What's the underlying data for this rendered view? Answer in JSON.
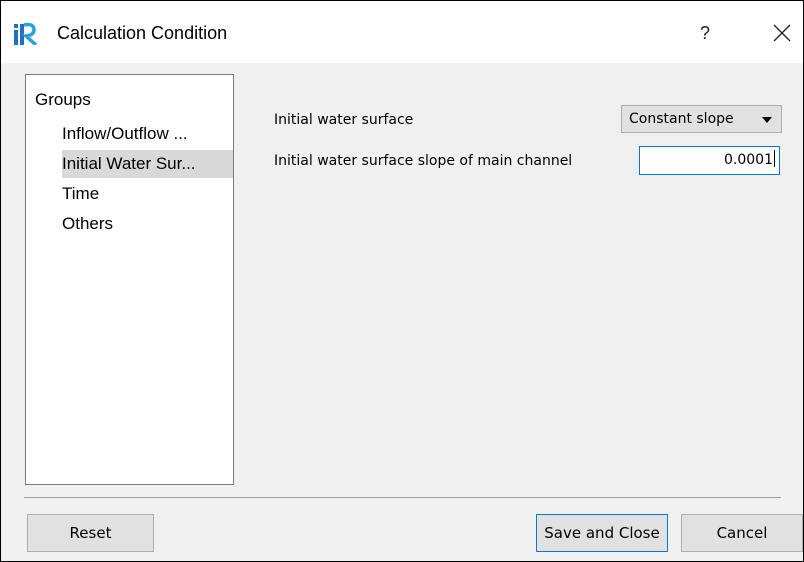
{
  "window": {
    "title": "Calculation Condition",
    "help_label": "?",
    "app_icon": "iric-logo-icon",
    "close_icon": "close-icon"
  },
  "groups": {
    "title": "Groups",
    "items": [
      {
        "label": "Inflow/Outflow ...",
        "selected": false
      },
      {
        "label": "Initial Water Sur...",
        "selected": true
      },
      {
        "label": "Time",
        "selected": false
      },
      {
        "label": "Others",
        "selected": false
      }
    ]
  },
  "fields": {
    "initial_surface": {
      "label": "Initial water surface",
      "value": "Constant slope"
    },
    "slope": {
      "label": "Initial water surface slope of main channel",
      "value": "0.0001"
    }
  },
  "buttons": {
    "reset": "Reset",
    "save": "Save and Close",
    "cancel": "Cancel"
  },
  "colors": {
    "focus_border": "#0078d7",
    "selection_bg": "#d9d9d9",
    "dialog_bg": "#f0f0f0"
  }
}
